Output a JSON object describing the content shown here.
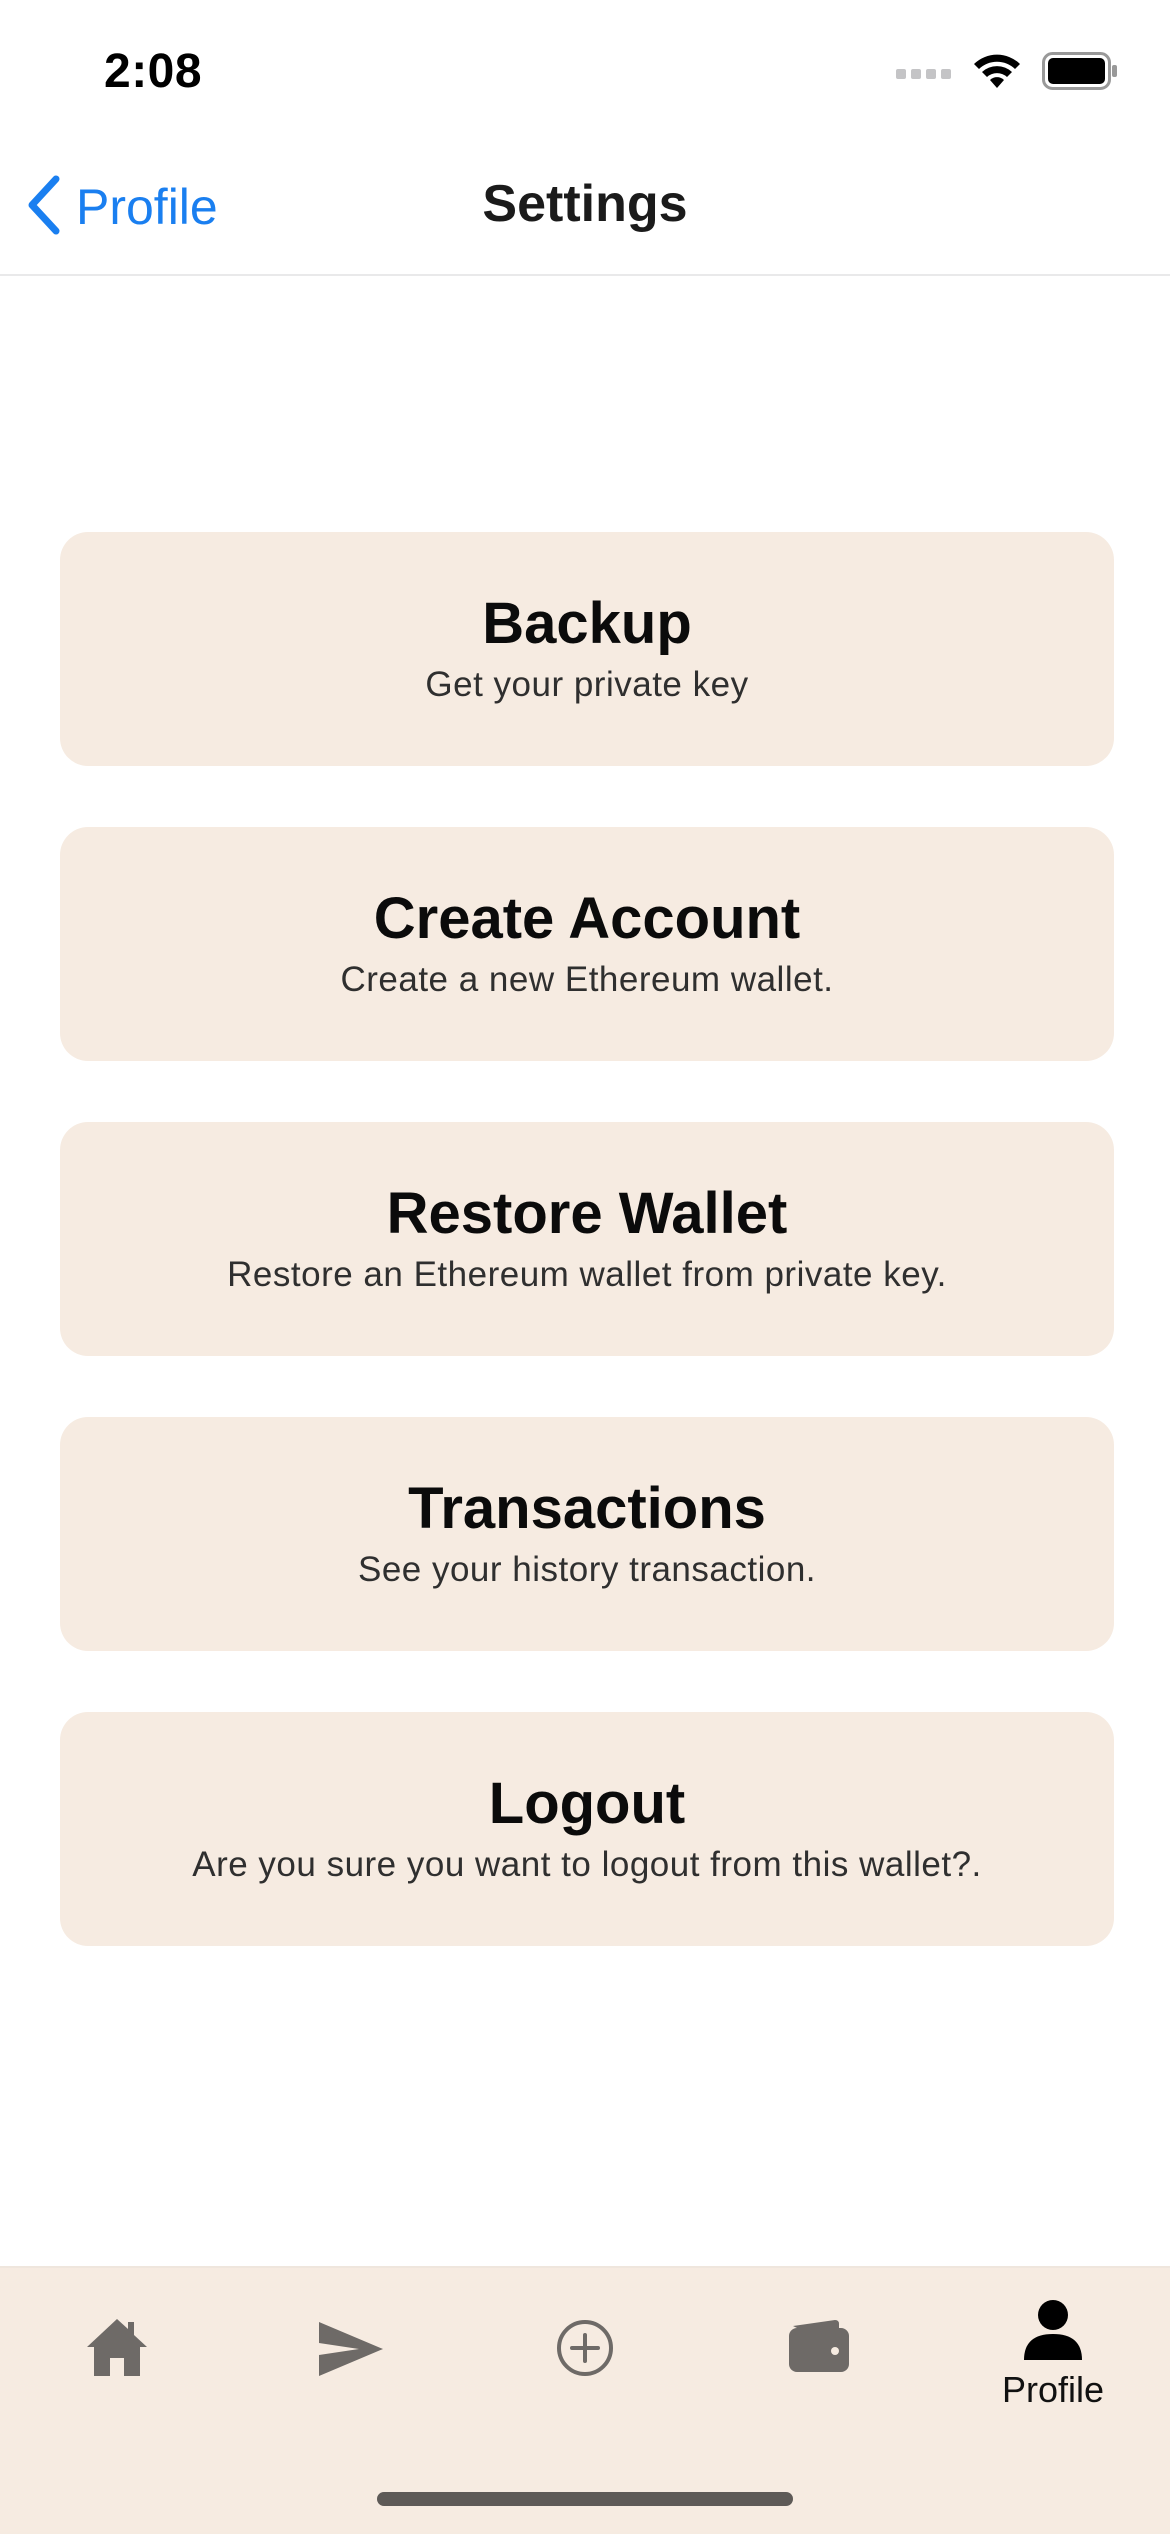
{
  "status_bar": {
    "time": "2:08",
    "icons": [
      "signal-icon",
      "wifi-icon",
      "battery-icon"
    ]
  },
  "nav": {
    "back_label": "Profile",
    "title": "Settings",
    "accent_color": "#1a7ff0"
  },
  "cards": [
    {
      "title": "Backup",
      "subtitle": "Get your private key"
    },
    {
      "title": "Create Account",
      "subtitle": "Create a new Ethereum wallet."
    },
    {
      "title": "Restore Wallet",
      "subtitle": "Restore an Ethereum wallet from private key."
    },
    {
      "title": "Transactions",
      "subtitle": "See your history transaction."
    },
    {
      "title": "Logout",
      "subtitle": "Are you sure you want to logout from this wallet?."
    }
  ],
  "tab_bar": {
    "background_color": "#f6ebe1",
    "tabs": [
      {
        "icon": "home-icon",
        "label": ""
      },
      {
        "icon": "send-icon",
        "label": ""
      },
      {
        "icon": "add-circle-icon",
        "label": ""
      },
      {
        "icon": "wallet-icon",
        "label": ""
      },
      {
        "icon": "person-icon",
        "label": "Profile",
        "selected": true
      }
    ]
  }
}
